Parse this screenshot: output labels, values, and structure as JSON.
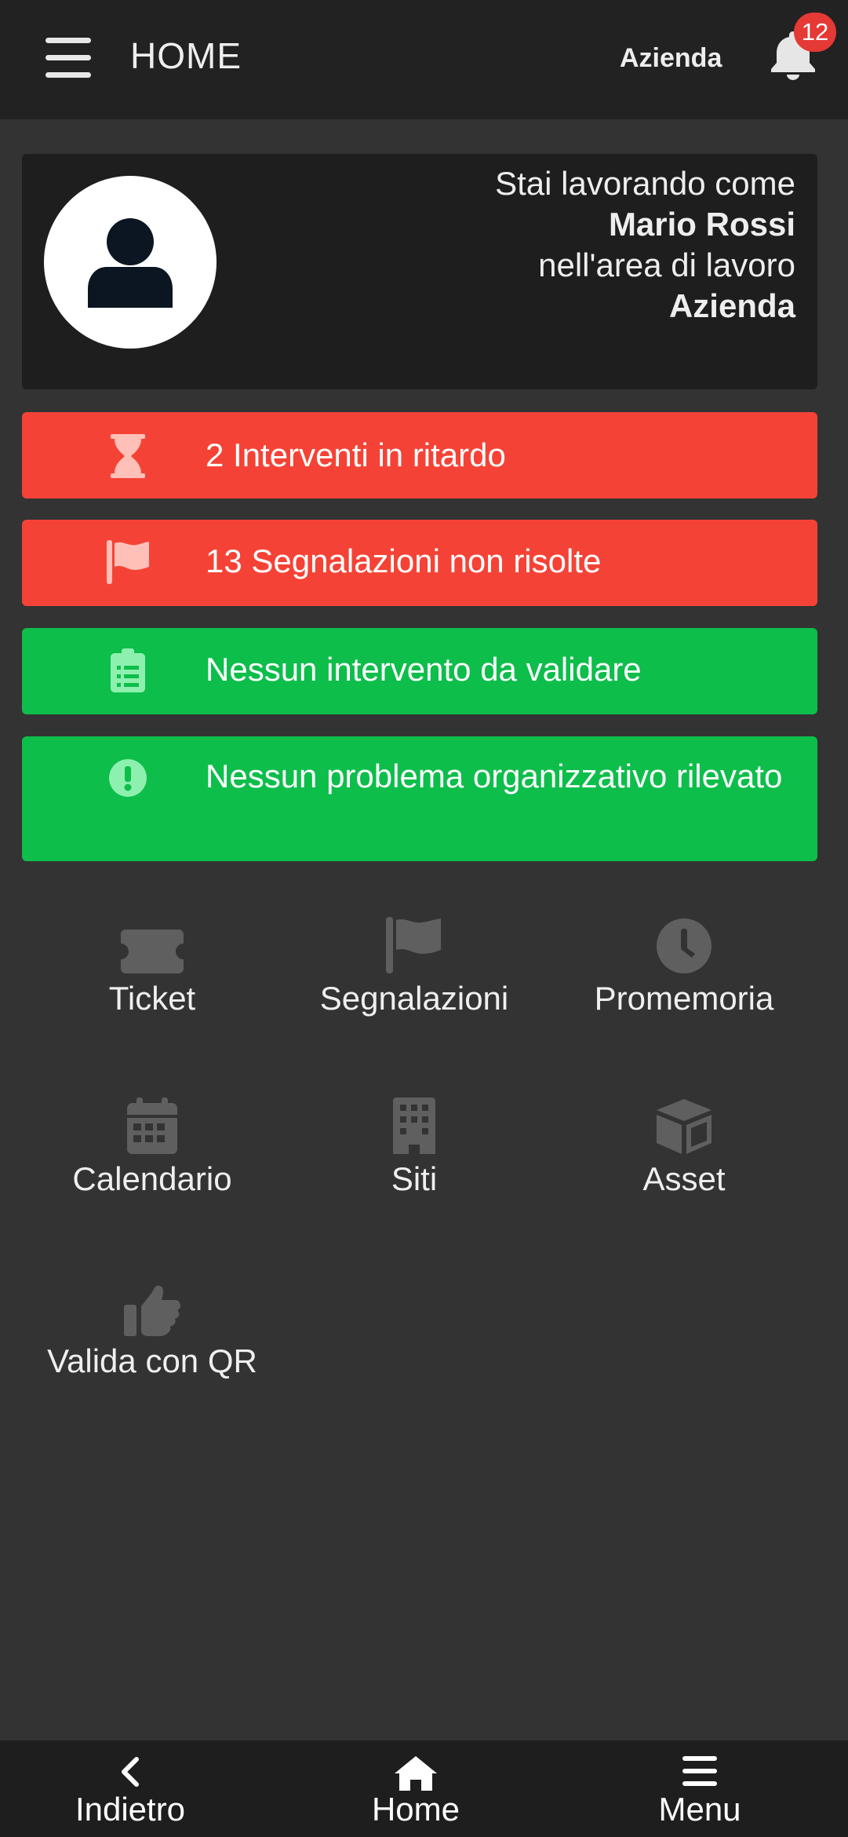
{
  "header": {
    "title": "HOME",
    "workspace": "Azienda",
    "notifications_count": "12"
  },
  "profile": {
    "line1": "Stai lavorando come",
    "user_name": "Mario Rossi",
    "line3": "nell'area di lavoro",
    "area_name": "Azienda"
  },
  "alerts": [
    {
      "text": "2 Interventi in ritardo",
      "icon": "hourglass-icon",
      "color": "#f44336"
    },
    {
      "text": "13 Segnalazioni non risolte",
      "icon": "flag-icon",
      "color": "#f44336"
    },
    {
      "text": "Nessun intervento da validare",
      "icon": "clipboard-icon",
      "color": "#0dbe4b"
    },
    {
      "text": "Nessun problema organizzativo rilevato",
      "icon": "exclamation-circle-icon",
      "color": "#0dbe4b"
    }
  ],
  "menu": [
    {
      "label": "Ticket",
      "icon": "ticket-icon"
    },
    {
      "label": "Segnalazioni",
      "icon": "flag-icon"
    },
    {
      "label": "Promemoria",
      "icon": "clock-icon"
    },
    {
      "label": "Calendario",
      "icon": "calendar-icon"
    },
    {
      "label": "Siti",
      "icon": "building-icon"
    },
    {
      "label": "Asset",
      "icon": "cube-icon"
    },
    {
      "label": "Valida con QR",
      "icon": "thumbs-up-icon"
    }
  ],
  "bottom_nav": {
    "back": "Indietro",
    "home": "Home",
    "menu": "Menu"
  },
  "colors": {
    "background": "#333333",
    "header": "#222222",
    "alert_red": "#f44336",
    "alert_green": "#0dbe4b",
    "icon_grey": "#5f5f5f"
  }
}
